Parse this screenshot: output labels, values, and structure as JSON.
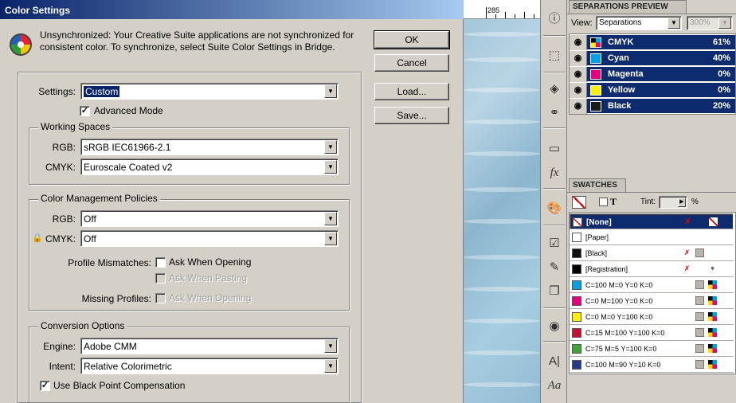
{
  "dialog": {
    "title": "Color Settings",
    "message": "Unsynchronized: Your Creative Suite applications are not synchronized for consistent color. To synchronize, select Suite Color Settings in Bridge.",
    "buttons": {
      "ok": "OK",
      "cancel": "Cancel",
      "load": "Load...",
      "save": "Save..."
    },
    "settings_label": "Settings:",
    "settings_value": "Custom",
    "advanced_mode_label": "Advanced Mode",
    "working_spaces": {
      "title": "Working Spaces",
      "rgb_label": "RGB:",
      "rgb_value": "sRGB IEC61966-2.1",
      "cmyk_label": "CMYK:",
      "cmyk_value": "Euroscale Coated v2"
    },
    "policies": {
      "title": "Color Management Policies",
      "rgb_label": "RGB:",
      "rgb_value": "Off",
      "cmyk_label": "CMYK:",
      "cmyk_value": "Off",
      "profile_mismatches_label": "Profile Mismatches:",
      "ask_opening": "Ask When Opening",
      "ask_pasting": "Ask When Pasting",
      "missing_profiles_label": "Missing Profiles:",
      "missing_ask_opening": "Ask When Opening"
    },
    "conversion": {
      "title": "Conversion Options",
      "engine_label": "Engine:",
      "engine_value": "Adobe CMM",
      "intent_label": "Intent:",
      "intent_value": "Relative Colorimetric",
      "black_point_label": "Use Black Point Compensation"
    }
  },
  "ruler": {
    "mark": "285"
  },
  "separations": {
    "tab": "SEPARATIONS PREVIEW",
    "view_label": "View:",
    "view_value": "Separations",
    "zoom_value": "300%",
    "rows": [
      {
        "name": "CMYK",
        "pct": "61%",
        "color": "cmyk"
      },
      {
        "name": "Cyan",
        "pct": "40%",
        "color": "#00a0e6"
      },
      {
        "name": "Magenta",
        "pct": "0%",
        "color": "#e6007e"
      },
      {
        "name": "Yellow",
        "pct": "0%",
        "color": "#fff000"
      },
      {
        "name": "Black",
        "pct": "20%",
        "color": "#1a1a1a"
      }
    ]
  },
  "swatches": {
    "tab": "SWATCHES",
    "tint_label": "Tint:",
    "tint_unit": "%",
    "rows": [
      {
        "name": "[None]",
        "color": "none"
      },
      {
        "name": "[Paper]",
        "color": "#ffffff"
      },
      {
        "name": "[Black]",
        "color": "#111111"
      },
      {
        "name": "[Registration]",
        "color": "#000000"
      },
      {
        "name": "C=100 M=0 Y=0 K=0",
        "color": "#00a0e6"
      },
      {
        "name": "C=0 M=100 Y=0 K=0",
        "color": "#e6007e"
      },
      {
        "name": "C=0 M=0 Y=100 K=0",
        "color": "#fff000"
      },
      {
        "name": "C=15 M=100 Y=100 K=0",
        "color": "#c8102e"
      },
      {
        "name": "C=75 M=5 Y=100 K=0",
        "color": "#3fa535"
      },
      {
        "name": "C=100 M=90 Y=10 K=0",
        "color": "#253a8e"
      }
    ]
  }
}
